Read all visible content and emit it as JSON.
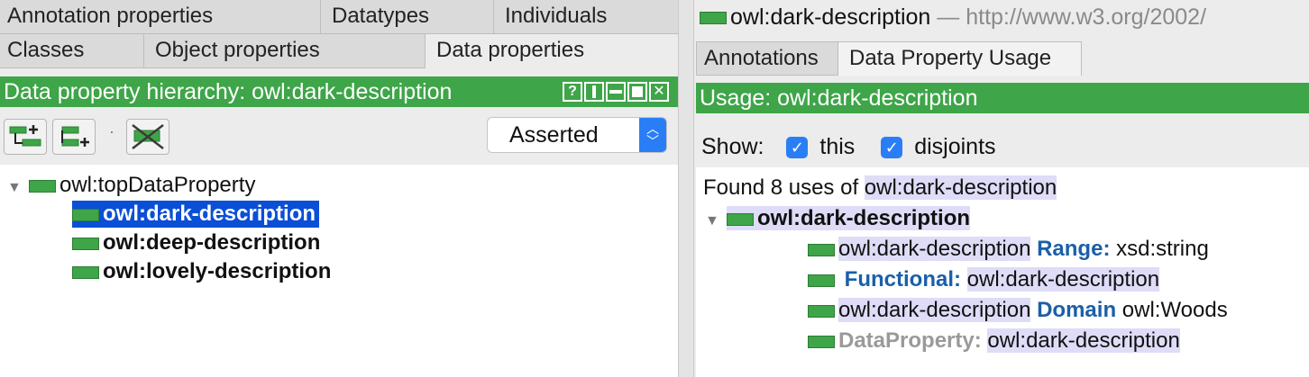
{
  "left": {
    "tabs_row1": [
      "Annotation properties",
      "Datatypes",
      "Individuals"
    ],
    "tabs_row2": [
      "Classes",
      "Object properties",
      "Data properties"
    ],
    "hierarchy_title": "Data property hierarchy: owl:dark-description",
    "inferred_select": "Asserted",
    "tree": {
      "root": "owl:topDataProperty",
      "children": [
        "owl:dark-description",
        "owl:deep-description",
        "owl:lovely-description"
      ]
    }
  },
  "right": {
    "entity_title": "owl:dark-description",
    "entity_iri": "— http://www.w3.org/2002/",
    "tabs": [
      "Annotations",
      "Data Property Usage"
    ],
    "usage_bar": "Usage: owl:dark-description",
    "show_label": "Show:",
    "check_this": "this",
    "check_disjoints": "disjoints",
    "found_prefix": "Found 8 uses of",
    "found_entity": "owl:dark-description",
    "usage_root": "owl:dark-description",
    "usages": [
      {
        "a": "owl:dark-description",
        "kw": "Range:",
        "b": "xsd:string"
      },
      {
        "a": "",
        "kw": "Functional:",
        "b": "owl:dark-description"
      },
      {
        "a": "owl:dark-description",
        "kw": "Domain",
        "b": "owl:Woods"
      },
      {
        "a": "",
        "kw": "DataProperty:",
        "b": "owl:dark-description"
      }
    ]
  },
  "colors": {
    "green": "#3ea548",
    "selection": "#0a4fd6",
    "highlight": "#dedcf7",
    "keyword": "#1b5fa8"
  },
  "icons": [
    "add-subproperty-icon",
    "add-sibling-icon",
    "delete-property-icon",
    "window-buttons-icon",
    "data-property-icon",
    "checkmark-icon"
  ]
}
